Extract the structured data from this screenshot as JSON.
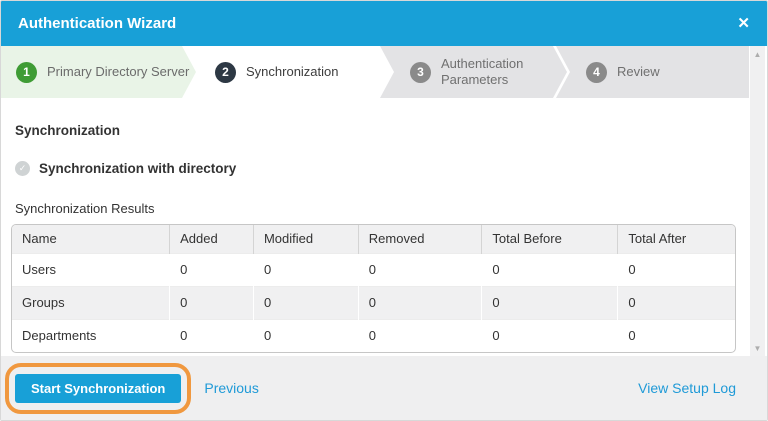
{
  "dialog": {
    "title": "Authentication Wizard",
    "close_icon": "✕"
  },
  "steps": [
    {
      "number": "1",
      "label": "Primary Directory Server",
      "state": "completed"
    },
    {
      "number": "2",
      "label": "Synchronization",
      "state": "active"
    },
    {
      "number": "3",
      "label": "Authentication Parameters",
      "state": "pending"
    },
    {
      "number": "4",
      "label": "Review",
      "state": "pending"
    }
  ],
  "content": {
    "section_title": "Synchronization",
    "sync_status_item": "Synchronization with directory",
    "results_label": "Synchronization Results",
    "table": {
      "headers": [
        "Name",
        "Added",
        "Modified",
        "Removed",
        "Total Before",
        "Total After"
      ],
      "rows": [
        [
          "Users",
          "0",
          "0",
          "0",
          "0",
          "0"
        ],
        [
          "Groups",
          "0",
          "0",
          "0",
          "0",
          "0"
        ],
        [
          "Departments",
          "0",
          "0",
          "0",
          "0",
          "0"
        ]
      ]
    }
  },
  "scrollbar": {
    "up_icon": "▲",
    "down_icon": "▼"
  },
  "icons": {
    "check": "✓"
  },
  "footer": {
    "start_button": "Start Synchronization",
    "previous_link": "Previous",
    "view_setup_log_link": "View Setup Log"
  },
  "colors": {
    "brand_blue": "#18a0d7",
    "link_blue": "#1f9ad7",
    "step_complete_green": "#3f9c35",
    "step_complete_bg": "#e9f4e7",
    "step_active_dark": "#2d3844",
    "step_pending_gray": "#8a8a8a",
    "highlight_orange": "#f0983f",
    "footer_bg": "#efeff0",
    "table_header_bg": "#f0f0f1"
  }
}
